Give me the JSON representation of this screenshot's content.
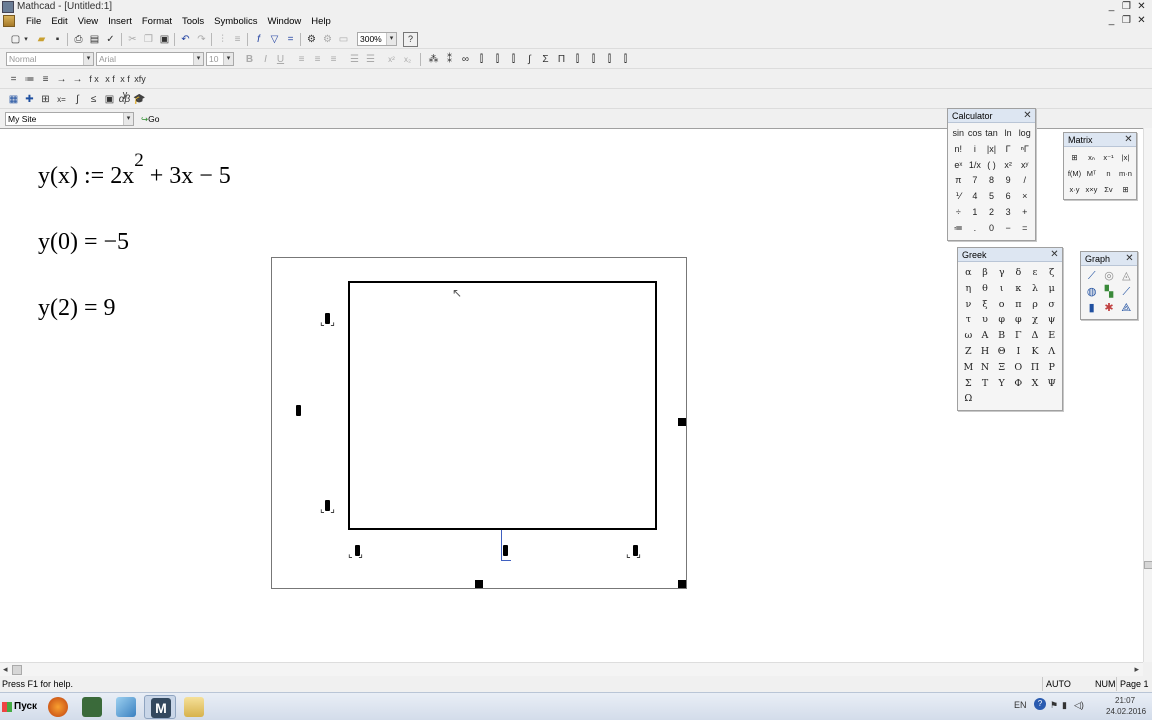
{
  "window": {
    "title": "Mathcad - [Untitled:1]",
    "app_controls": [
      "_",
      "❐",
      "✕"
    ],
    "doc_controls": [
      "_",
      "❐",
      "✕"
    ]
  },
  "menu": [
    "File",
    "Edit",
    "View",
    "Insert",
    "Format",
    "Tools",
    "Symbolics",
    "Window",
    "Help"
  ],
  "toolbar": {
    "zoom": "300%",
    "style": "Normal",
    "font": "Arial",
    "font_size": "10",
    "math_ops": [
      "=",
      "≔",
      "≡",
      "→",
      "→",
      "f x",
      "x f",
      "x f y",
      "xfy"
    ]
  },
  "resources": {
    "site": "My Site",
    "go_label": "Go"
  },
  "worksheet": {
    "def": {
      "lhs": "y(x) := 2x",
      "exp": "2",
      "rhs": " + 3x − 5"
    },
    "eval1": "y(0) = −5",
    "eval2": "y(2) = 9"
  },
  "palettes": {
    "calculator": {
      "title": "Calculator",
      "buttons": [
        "sin",
        "cos",
        "tan",
        "ln",
        "log",
        "n!",
        "i",
        "|x|",
        "Γ",
        "ⁿΓ",
        "eˣ",
        "1/x",
        "( )",
        "x²",
        "xʸ",
        "π",
        "7",
        "8",
        "9",
        "/",
        "⅟",
        "4",
        "5",
        "6",
        "×",
        "÷",
        "1",
        "2",
        "3",
        "+",
        "≔",
        ".",
        "0",
        "−",
        "="
      ]
    },
    "matrix": {
      "title": "Matrix",
      "buttons": [
        "[:::]",
        "xₙ",
        "x⁻¹",
        "|x|",
        "f(M)",
        "Mᵀ",
        "n",
        "m·n",
        "x·y",
        "x×y",
        "Σv",
        "⊞"
      ]
    },
    "greek": {
      "title": "Greek",
      "letters": [
        "α",
        "β",
        "γ",
        "δ",
        "ε",
        "ζ",
        "η",
        "θ",
        "ι",
        "κ",
        "λ",
        "μ",
        "ν",
        "ξ",
        "ο",
        "π",
        "ρ",
        "σ",
        "τ",
        "υ",
        "φ",
        "φ",
        "χ",
        "ψ",
        "ω",
        "Α",
        "Β",
        "Γ",
        "Δ",
        "Ε",
        "Ζ",
        "Η",
        "Θ",
        "Ι",
        "Κ",
        "Λ",
        "Μ",
        "Ν",
        "Ξ",
        "Ο",
        "Π",
        "Ρ",
        "Σ",
        "Τ",
        "Υ",
        "Φ",
        "Χ",
        "Ψ",
        "Ω"
      ]
    },
    "graph": {
      "title": "Graph",
      "buttons": [
        "x-y plot",
        "polar",
        "surface",
        "contour",
        "3d scatter",
        "3d bar",
        "vector",
        "",
        ""
      ]
    }
  },
  "status": {
    "help": "Press F1 for help.",
    "mode": "AUTO",
    "num": "NUM",
    "page": "Page 1"
  },
  "taskbar": {
    "start": "Пуск",
    "lang": "EN",
    "time": "21:07",
    "date": "24.02.2016"
  }
}
